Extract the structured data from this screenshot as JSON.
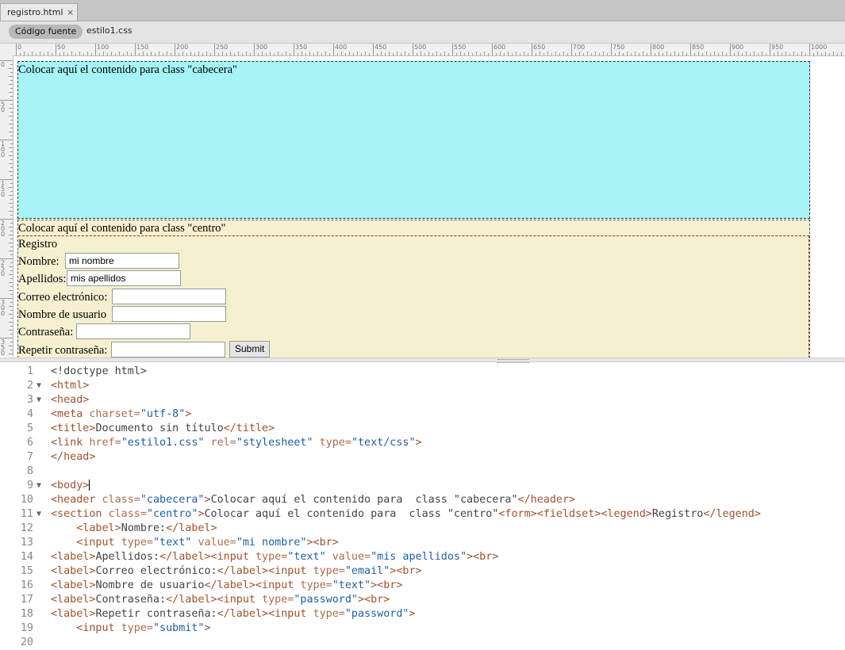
{
  "tab": {
    "title": "registro.html",
    "close": "×"
  },
  "related_files": {
    "source": "Código fuente",
    "css": "estilo1.css"
  },
  "ruler": {
    "labels": [
      "0",
      "50",
      "100",
      "150",
      "200",
      "250",
      "300",
      "350",
      "400",
      "450",
      "500",
      "550",
      "600",
      "650",
      "700",
      "750",
      "800",
      "850",
      "900",
      "950",
      "1000"
    ],
    "vlabels": [
      "0",
      "50",
      "100",
      "150",
      "200",
      "250",
      "300",
      "350"
    ]
  },
  "design": {
    "cabecera_text": "Colocar aquí el contenido para class \"cabecera\"",
    "centro_text": "Colocar aquí el contenido para class \"centro\"",
    "legend": "Registro",
    "fields": {
      "nombre_label": "Nombre:",
      "nombre_value": "mi nombre",
      "apellidos_label": "Apellidos:",
      "apellidos_value": "mis apellidos",
      "correo_label": "Correo electrónico:",
      "usuario_label": "Nombre de usuario",
      "pass_label": "Contraseña:",
      "pass2_label": "Repetir contraseña:",
      "submit": "Submit"
    }
  },
  "code_lines": [
    {
      "n": "1",
      "fold": "",
      "html": "<span class='tx'>&lt;!doctype html&gt;</span>"
    },
    {
      "n": "2",
      "fold": "▼",
      "html": "<span class='t'>&lt;html&gt;</span>"
    },
    {
      "n": "3",
      "fold": "▼",
      "html": "<span class='t'>&lt;head&gt;</span>"
    },
    {
      "n": "4",
      "fold": "",
      "html": "<span class='t'>&lt;meta</span> <span class='a'>charset=</span><span class='v'>\"utf-8\"</span><span class='t'>&gt;</span>"
    },
    {
      "n": "5",
      "fold": "",
      "html": "<span class='t'>&lt;title&gt;</span><span class='tx'>Documento sin título</span><span class='t'>&lt;/title&gt;</span>"
    },
    {
      "n": "6",
      "fold": "",
      "html": "<span class='t'>&lt;link</span> <span class='a'>href=</span><span class='v'>\"estilo1.css\"</span> <span class='a'>rel=</span><span class='v'>\"stylesheet\"</span> <span class='a'>type=</span><span class='v'>\"text/css\"</span><span class='t'>&gt;</span>"
    },
    {
      "n": "7",
      "fold": "",
      "html": "<span class='t'>&lt;/head&gt;</span>"
    },
    {
      "n": "8",
      "fold": "",
      "html": ""
    },
    {
      "n": "9",
      "fold": "▼",
      "html": "<span class='t'>&lt;body&gt;</span><span class='cursor'></span>"
    },
    {
      "n": "10",
      "fold": "",
      "html": "<span class='t'>&lt;header</span> <span class='a'>class=</span><span class='v'>\"cabecera\"</span><span class='t'>&gt;</span><span class='tx'>Colocar aquí el contenido para  class \"cabecera\"</span><span class='t'>&lt;/header&gt;</span>"
    },
    {
      "n": "11",
      "fold": "▼",
      "html": "<span class='t'>&lt;section</span> <span class='a'>class=</span><span class='v'>\"centro\"</span><span class='t'>&gt;</span><span class='tx'>Colocar aquí el contenido para  class \"centro\"</span><span class='t'>&lt;form&gt;&lt;fieldset&gt;&lt;legend&gt;</span><span class='tx'>Registro</span><span class='t'>&lt;/legend&gt;</span>"
    },
    {
      "n": "12",
      "fold": "",
      "html": "    <span class='t'>&lt;label&gt;</span><span class='tx'>Nombre:</span><span class='t'>&lt;/label&gt;</span>"
    },
    {
      "n": "13",
      "fold": "",
      "html": "    <span class='t'>&lt;input</span> <span class='a'>type=</span><span class='v'>\"text\"</span> <span class='a'>value=</span><span class='v'>\"mi nombre\"</span><span class='t'>&gt;&lt;br&gt;</span>"
    },
    {
      "n": "14",
      "fold": "",
      "html": "<span class='t'>&lt;label&gt;</span><span class='tx'>Apellidos:</span><span class='t'>&lt;/label&gt;&lt;input</span> <span class='a'>type=</span><span class='v'>\"text\"</span> <span class='a'>value=</span><span class='v'>\"mis apellidos\"</span><span class='t'>&gt;&lt;br&gt;</span>"
    },
    {
      "n": "15",
      "fold": "",
      "html": "<span class='t'>&lt;label&gt;</span><span class='tx'>Correo electrónico:</span><span class='t'>&lt;/label&gt;&lt;input</span> <span class='a'>type=</span><span class='v'>\"email\"</span><span class='t'>&gt;&lt;br&gt;</span>"
    },
    {
      "n": "16",
      "fold": "",
      "html": "<span class='t'>&lt;label&gt;</span><span class='tx'>Nombre de usuario</span><span class='t'>&lt;/label&gt;&lt;input</span> <span class='a'>type=</span><span class='v'>\"text\"</span><span class='t'>&gt;&lt;br&gt;</span>"
    },
    {
      "n": "17",
      "fold": "",
      "html": "<span class='t'>&lt;label&gt;</span><span class='tx'>Contraseña:</span><span class='t'>&lt;/label&gt;&lt;input</span> <span class='a'>type=</span><span class='v'>\"password\"</span><span class='t'>&gt;&lt;br&gt;</span>"
    },
    {
      "n": "18",
      "fold": "",
      "html": "<span class='t'>&lt;label&gt;</span><span class='tx'>Repetir contraseña:</span><span class='t'>&lt;/label&gt;&lt;input</span> <span class='a'>type=</span><span class='v'>\"password\"</span><span class='t'>&gt;</span>"
    },
    {
      "n": "19",
      "fold": "",
      "html": "    <span class='t'>&lt;input</span> <span class='a'>type=</span><span class='v'>\"submit\"</span><span class='t'>&gt;</span>"
    },
    {
      "n": "20",
      "fold": "",
      "html": ""
    }
  ]
}
